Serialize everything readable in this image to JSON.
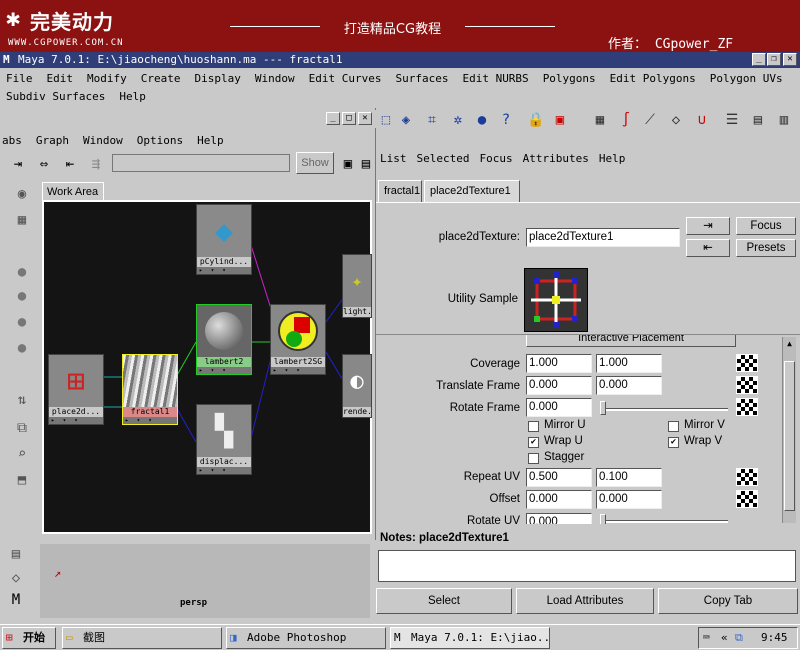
{
  "banner": {
    "logo": "完美动力",
    "url": "WWW.CGPOWER.COM.CN",
    "title": "打造精品CG教程",
    "author": "作者： CGpower_ZF"
  },
  "window": {
    "title": "Maya 7.0.1: E:\\jiaocheng\\huoshann.ma   ---   fractal1"
  },
  "menubar": {
    "row1": [
      "File",
      "Edit",
      "Modify",
      "Create",
      "Display",
      "Window",
      "Edit Curves",
      "Surfaces",
      "Edit NURBS",
      "Polygons",
      "Edit Polygons",
      "Polygon UVs"
    ],
    "row2": [
      "Subdiv Surfaces",
      "Help"
    ]
  },
  "hypershade": {
    "menu": [
      "abs",
      "Graph",
      "Window",
      "Options",
      "Help"
    ],
    "show_label": "Show",
    "work_area_tab": "Work Area",
    "nodes": {
      "pcylinder": "pCylind...",
      "lambert2": "lambert2",
      "lambert2sg": "lambert2SG",
      "light": "light...",
      "place2d": "place2d...",
      "fractal1": "fractal1",
      "displace": "displac...",
      "render": "rende..."
    },
    "persp": "persp"
  },
  "attr_editor": {
    "menu": [
      "List",
      "Selected",
      "Focus",
      "Attributes",
      "Help"
    ],
    "tabs": [
      "fractal1",
      "place2dTexture1"
    ],
    "node_label": "place2dTexture:",
    "node_name": "place2dTexture1",
    "focus": "Focus",
    "presets": "Presets",
    "utility_sample": "Utility Sample",
    "section": "Interactive Placement",
    "coverage": {
      "label": "Coverage",
      "u": "1.000",
      "v": "1.000"
    },
    "translate_frame": {
      "label": "Translate Frame",
      "u": "0.000",
      "v": "0.000"
    },
    "rotate_frame": {
      "label": "Rotate Frame",
      "value": "0.000"
    },
    "mirror_u": {
      "label": "Mirror U",
      "checked": false
    },
    "mirror_v": {
      "label": "Mirror V",
      "checked": false
    },
    "wrap_u": {
      "label": "Wrap U",
      "checked": true
    },
    "wrap_v": {
      "label": "Wrap V",
      "checked": true
    },
    "stagger": {
      "label": "Stagger",
      "checked": false
    },
    "repeat_uv": {
      "label": "Repeat UV",
      "u": "0.500",
      "v": "0.100"
    },
    "offset": {
      "label": "Offset",
      "u": "0.000",
      "v": "0.000"
    },
    "rotate_uv": {
      "label": "Rotate UV",
      "value": "0.000"
    },
    "notes_label": "Notes: place2dTexture1",
    "select": "Select",
    "load_attributes": "Load Attributes",
    "copy_tab": "Copy Tab"
  },
  "taskbar": {
    "start": "开始",
    "items": [
      "截图",
      "Adobe Photoshop",
      "Maya 7.0.1: E:\\jiao..."
    ],
    "clock": "9:45"
  },
  "colors": {
    "banner": "#8c1212",
    "titlebar": "#2f3e78",
    "canvas": "#141414"
  }
}
